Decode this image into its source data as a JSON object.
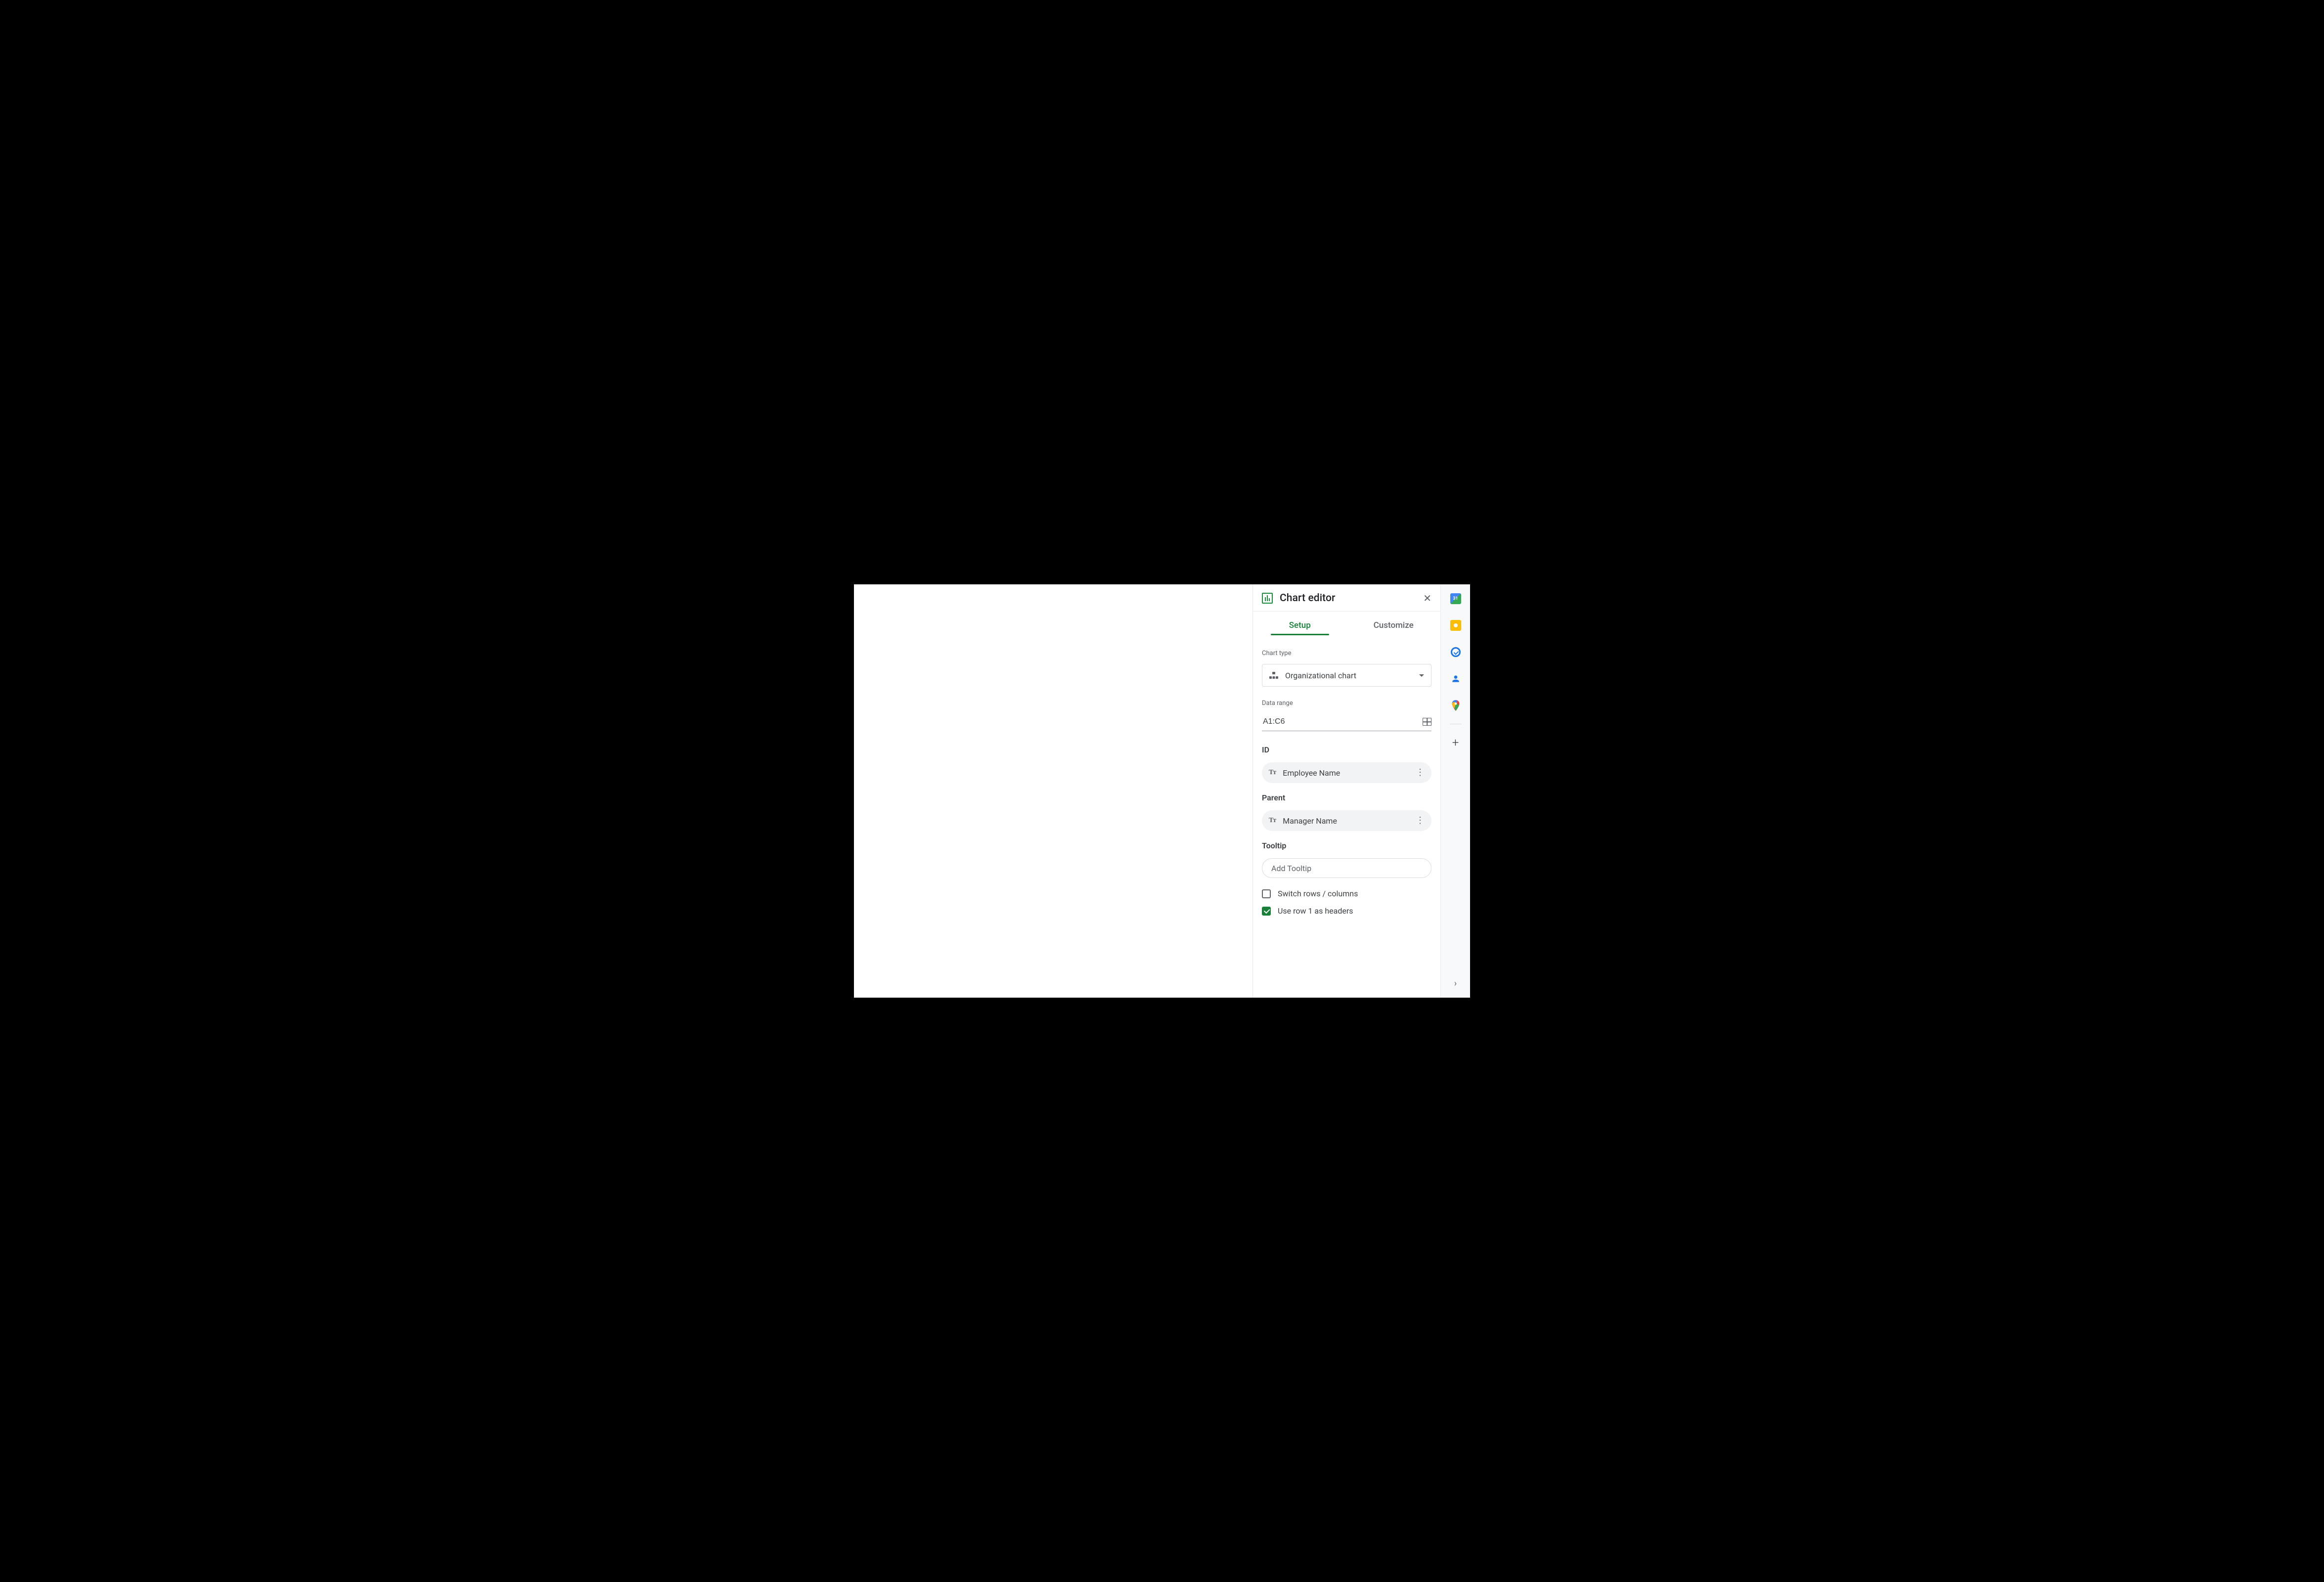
{
  "panel": {
    "title": "Chart editor",
    "tabs": {
      "setup": "Setup",
      "customize": "Customize"
    },
    "chart_type": {
      "label": "Chart type",
      "value": "Organizational chart"
    },
    "data_range": {
      "label": "Data range",
      "value": "A1:C6"
    },
    "id": {
      "heading": "ID",
      "value": "Employee Name"
    },
    "parent": {
      "heading": "Parent",
      "value": "Manager Name"
    },
    "tooltip": {
      "heading": "Tooltip",
      "add_label": "Add Tooltip"
    },
    "switch_rows": {
      "label": "Switch rows / columns",
      "checked": false
    },
    "use_headers": {
      "label": "Use row 1 as headers",
      "checked": true
    }
  },
  "side_rail": {
    "calendar_day": "31"
  }
}
